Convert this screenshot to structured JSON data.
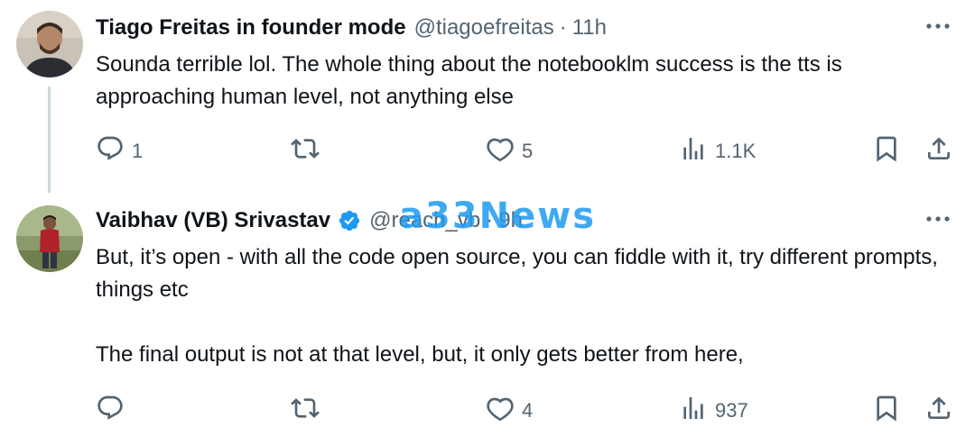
{
  "tweets": [
    {
      "name": "Tiago Freitas in founder mode",
      "handle": "@tiagoefreitas",
      "separator": "·",
      "time": "11h",
      "verified": false,
      "text": [
        "Sounda terrible lol. The whole thing about the notebooklm success is the tts is approaching human level, not anything else"
      ],
      "replies": "1",
      "reposts": "",
      "likes": "5",
      "views": "1.1K"
    },
    {
      "name": "Vaibhav (VB) Srivastav",
      "handle": "@reach_vb",
      "separator": "·",
      "time": "9h",
      "verified": true,
      "text": [
        "But, it’s open - with all the code open source, you can fiddle with it, try different prompts, things etc",
        "The final output is not at that level, but, it only gets better from here,"
      ],
      "replies": "",
      "reposts": "",
      "likes": "4",
      "views": "937"
    }
  ],
  "watermark": "a33News",
  "colors": {
    "text": "#0f1419",
    "secondary": "#536471",
    "accent": "#1d9bf0",
    "thread_line": "#cfd9de"
  }
}
